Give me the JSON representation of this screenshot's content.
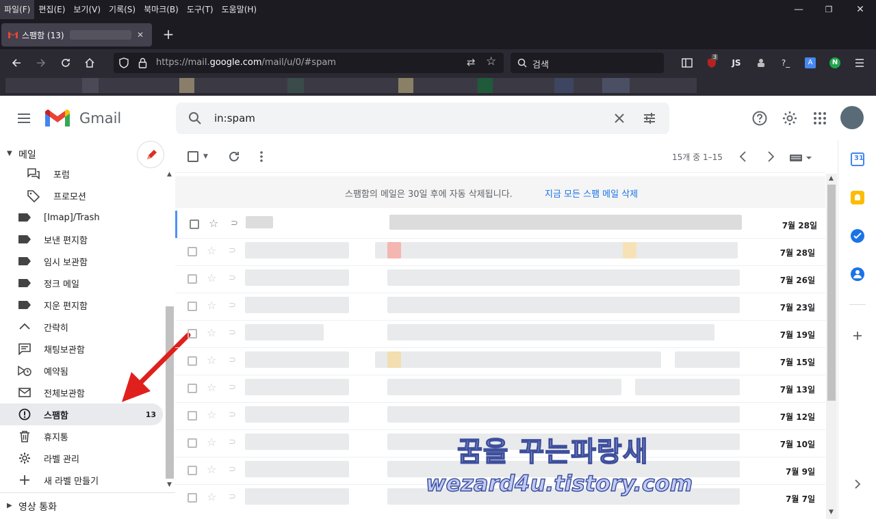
{
  "menubar": {
    "items": [
      "파일(F)",
      "편집(E)",
      "보기(V)",
      "기록(S)",
      "북마크(B)",
      "도구(T)",
      "도움말(H)"
    ]
  },
  "window_controls": {
    "minimize": "—",
    "restore": "❐",
    "close": "✕"
  },
  "tab": {
    "title": "스팸함 (13)",
    "close": "✕",
    "new_tab": "+"
  },
  "address": {
    "url_prefix": "https://mail.",
    "url_domain": "google.com",
    "url_suffix": "/mail/u/0/#spam"
  },
  "browser_search": {
    "placeholder": "검색"
  },
  "extension_badge": "3",
  "gmail": {
    "logo_text": "Gmail",
    "search_value": "in:spam",
    "section_mail": "메일",
    "section_video": "영상 통화",
    "sidebar": [
      {
        "label": "포럼",
        "icon": "forum-icon"
      },
      {
        "label": "프로모션",
        "icon": "tag-icon"
      },
      {
        "label": "[Imap]/Trash",
        "icon": "label-icon"
      },
      {
        "label": "보낸 편지함",
        "icon": "label-icon"
      },
      {
        "label": "임시 보관함",
        "icon": "label-icon"
      },
      {
        "label": "정크 메일",
        "icon": "label-icon"
      },
      {
        "label": "지운 편지함",
        "icon": "label-icon"
      },
      {
        "label": "간략히",
        "icon": "chevron-up-icon"
      },
      {
        "label": "채팅보관함",
        "icon": "chat-icon"
      },
      {
        "label": "예약됨",
        "icon": "scheduled-icon"
      },
      {
        "label": "전체보관함",
        "icon": "mail-icon"
      },
      {
        "label": "스팸함",
        "icon": "spam-icon",
        "count": "13",
        "active": true
      },
      {
        "label": "휴지통",
        "icon": "trash-icon"
      },
      {
        "label": "라벨 관리",
        "icon": "gear-icon"
      },
      {
        "label": "새 라벨 만들기",
        "icon": "plus-icon"
      }
    ],
    "pagination": "15개 중 1–15",
    "notice": "스팸함의 메일은 30일 후에 자동 삭제됩니다.",
    "notice_action": "지금 모든 스팸 메일 삭제",
    "dates": [
      "7월 28일",
      "7월 28일",
      "7월 26일",
      "7월 23일",
      "7월 19일",
      "7월 15일",
      "7월 13일",
      "7월 12일",
      "7월 10일",
      "7월 9일",
      "7월 7일"
    ]
  },
  "watermark": {
    "line1": "꿈을 꾸는파랑새",
    "line2": "wezard4u.tistory.com"
  },
  "colors": {
    "accent": "#1a73e8",
    "arrow": "#e0201c",
    "gmail_red": "#ea4335"
  }
}
